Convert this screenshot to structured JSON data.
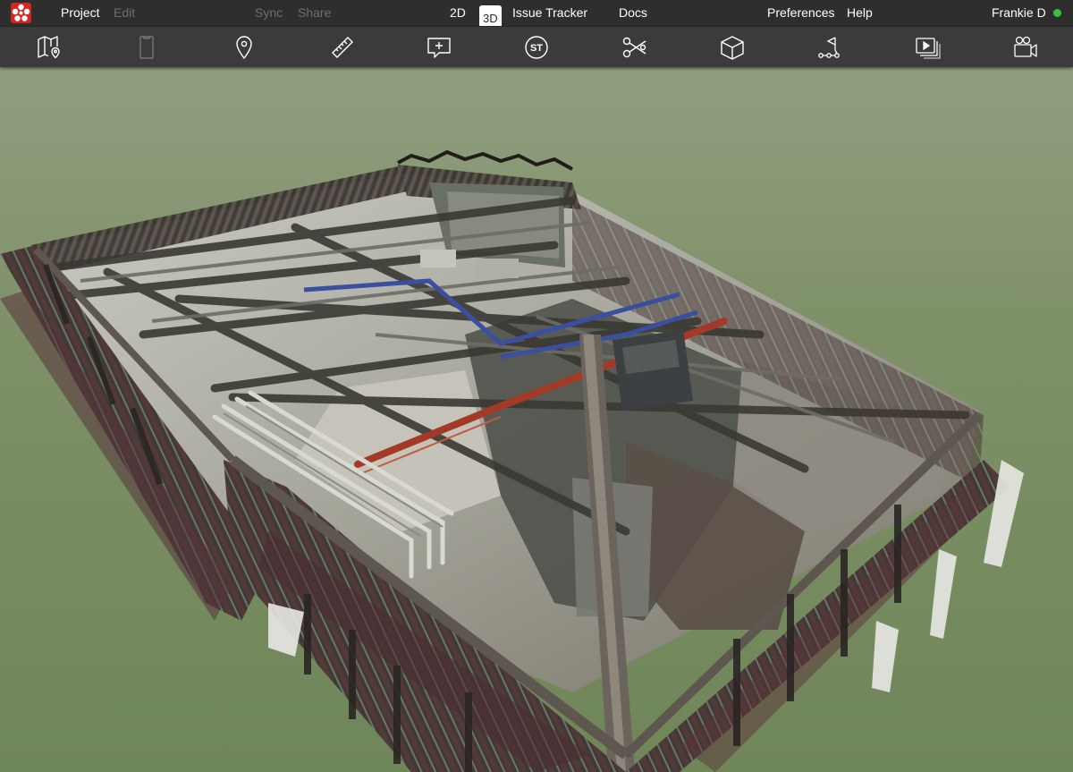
{
  "menubar": {
    "project": "Project",
    "edit": "Edit",
    "sync": "Sync",
    "share": "Share",
    "mode_2d": "2D",
    "mode_3d": "3D",
    "issue_tracker": "Issue Tracker",
    "docs": "Docs",
    "preferences": "Preferences",
    "help": "Help",
    "user": "Frankie D"
  },
  "toolbar": {
    "tools": [
      {
        "icon": "map-pin-icon"
      },
      {
        "icon": "clipboard-icon",
        "state": "disabled"
      },
      {
        "icon": "location-pin-icon"
      },
      {
        "icon": "ruler-icon"
      },
      {
        "icon": "add-comment-icon"
      },
      {
        "icon": "st-icon",
        "label": "ST"
      },
      {
        "icon": "scissors-icon"
      },
      {
        "icon": "cube-icon"
      },
      {
        "icon": "path-flag-icon"
      },
      {
        "icon": "gallery-icon"
      },
      {
        "icon": "video-camera-icon"
      }
    ]
  },
  "colors": {
    "menubar_bg": "#2e2e2e",
    "toolbar_bg": "#3b3b3b",
    "logo_red": "#d7261d",
    "online_green": "#3fbf3f",
    "sky_top": "#8c9c7a",
    "ground": "#748a60",
    "pipe_red": "#a33a28",
    "pipe_blue": "#3a4fa0"
  }
}
